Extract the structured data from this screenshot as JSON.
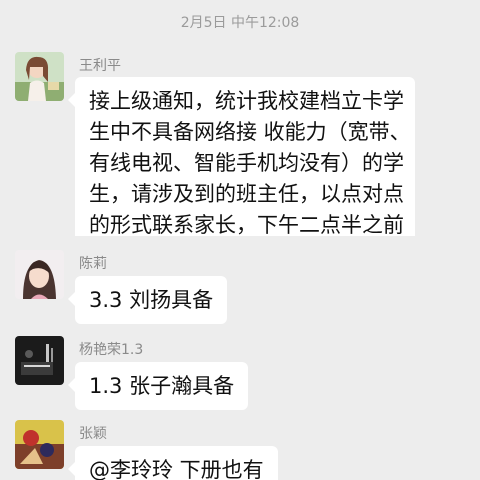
{
  "chat": {
    "timestamp": "2月5日 中午12:08",
    "messages": [
      {
        "sender": "王利平",
        "avatar_icon": "profile-photo-icon",
        "lines": [
          "接上级通知，统计我校建档立卡学",
          "生中不具备网络接 收能力（宽带、",
          "有线电视、智能手机均没有）的学",
          "生，请涉及到的班主任，以点对点",
          "的形式联系家长，下午二点半之前"
        ]
      },
      {
        "sender": "陈莉",
        "avatar_icon": "profile-photo-icon",
        "text": "3.3 刘扬具备"
      },
      {
        "sender": "杨艳荣1.3",
        "avatar_icon": "profile-photo-icon",
        "text": "1.3 张子瀚具备"
      },
      {
        "sender": "张颖",
        "avatar_icon": "profile-photo-icon",
        "text": "@李玲玲  下册也有"
      }
    ]
  }
}
